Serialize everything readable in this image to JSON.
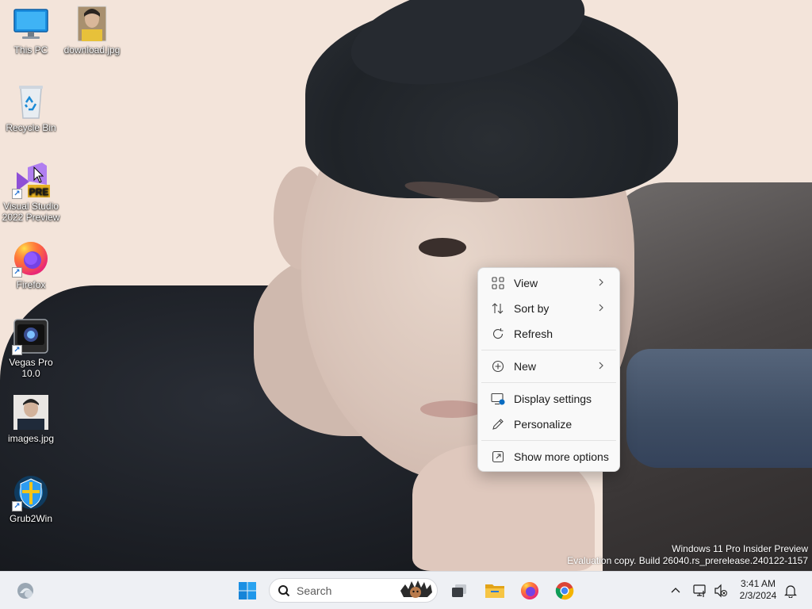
{
  "desktop": {
    "icons": [
      {
        "label": "This PC"
      },
      {
        "label": "download.jpg"
      },
      {
        "label": "Recycle Bin"
      },
      {
        "label": "Visual Studio 2022 Preview",
        "badge": "PRE"
      },
      {
        "label": "Firefox"
      },
      {
        "label": "Vegas Pro 10.0"
      },
      {
        "label": "images.jpg"
      },
      {
        "label": "Grub2Win"
      }
    ],
    "watermark": {
      "line1": "Windows 11 Pro Insider Preview",
      "line2": "Evaluation copy. Build 26040.rs_prerelease.240122-1157"
    }
  },
  "context_menu": {
    "items": [
      {
        "label": "View",
        "icon": "grid-icon",
        "submenu": true
      },
      {
        "label": "Sort by",
        "icon": "sort-icon",
        "submenu": true
      },
      {
        "label": "Refresh",
        "icon": "refresh-icon",
        "submenu": false
      },
      {
        "label": "New",
        "icon": "add-circle-icon",
        "submenu": true
      },
      {
        "label": "Display settings",
        "icon": "display-settings-icon",
        "submenu": false
      },
      {
        "label": "Personalize",
        "icon": "pen-icon",
        "submenu": false
      },
      {
        "label": "Show more options",
        "icon": "open-external-icon",
        "submenu": false
      }
    ]
  },
  "taskbar": {
    "search_placeholder": "Search",
    "pinned": [
      "widgets-icon",
      "start-icon",
      "task-view-icon",
      "file-explorer-icon",
      "firefox-icon",
      "chrome-icon"
    ],
    "clock": {
      "time": "3:41 AM",
      "date": "2/3/2024"
    }
  },
  "colors": {
    "accent": "#0078d4",
    "menu_bg": "#f9f9f9",
    "taskbar_bg": "#eef0f4"
  }
}
